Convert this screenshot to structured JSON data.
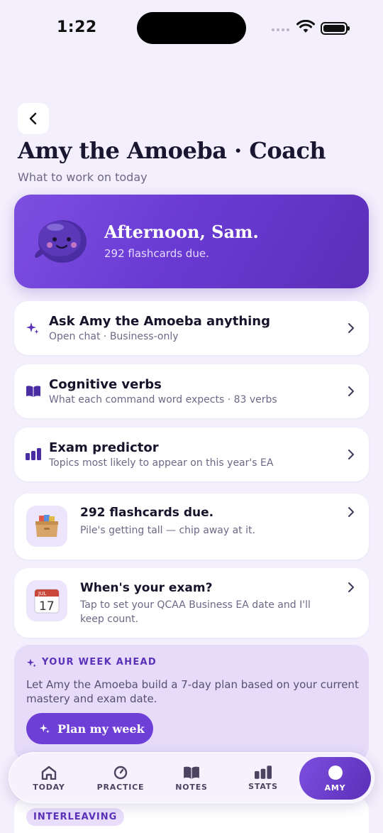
{
  "status_bar": {
    "time": "1:22"
  },
  "header": {
    "title": "Amy the Amoeba · Coach",
    "subtitle": "What to work on today"
  },
  "hero": {
    "greeting": "Afternoon, Sam.",
    "subtitle": "292 flashcards due."
  },
  "menu": [
    {
      "title": "Ask Amy the Amoeba anything",
      "subtitle": "Open chat · Business-only",
      "icon": "sparkle-icon"
    },
    {
      "title": "Cognitive verbs",
      "subtitle": "What each command word expects · 83 verbs",
      "icon": "book-icon"
    },
    {
      "title": "Exam predictor",
      "subtitle": "Topics most likely to appear on this year's EA",
      "icon": "bar-chart-icon"
    }
  ],
  "flashcards": {
    "title": "292 flashcards due.",
    "subtitle": "Pile's getting tall — chip away at it.",
    "icon": "card-file-box-icon"
  },
  "exam": {
    "title": "When's your exam?",
    "subtitle": "Tap to set your QCAA Business EA date and I'll keep count.",
    "calendar_month": "JUL",
    "calendar_day": "17"
  },
  "week": {
    "eyebrow": "YOUR WEEK AHEAD",
    "text": "Let Amy the Amoeba build a 7-day plan based on your current mastery and exam date.",
    "button": "Plan my week"
  },
  "next_section": {
    "pill": "INTERLEAVING"
  },
  "tabs": [
    {
      "label": "TODAY",
      "icon": "home-icon"
    },
    {
      "label": "PRACTICE",
      "icon": "timer-icon"
    },
    {
      "label": "NOTES",
      "icon": "book-icon"
    },
    {
      "label": "STATS",
      "icon": "bar-chart-icon"
    },
    {
      "label": "AMY",
      "icon": "circle-icon",
      "active": true
    }
  ],
  "colors": {
    "accent": "#6e3fd6",
    "background": "#f3effc",
    "card": "#ffffff"
  }
}
